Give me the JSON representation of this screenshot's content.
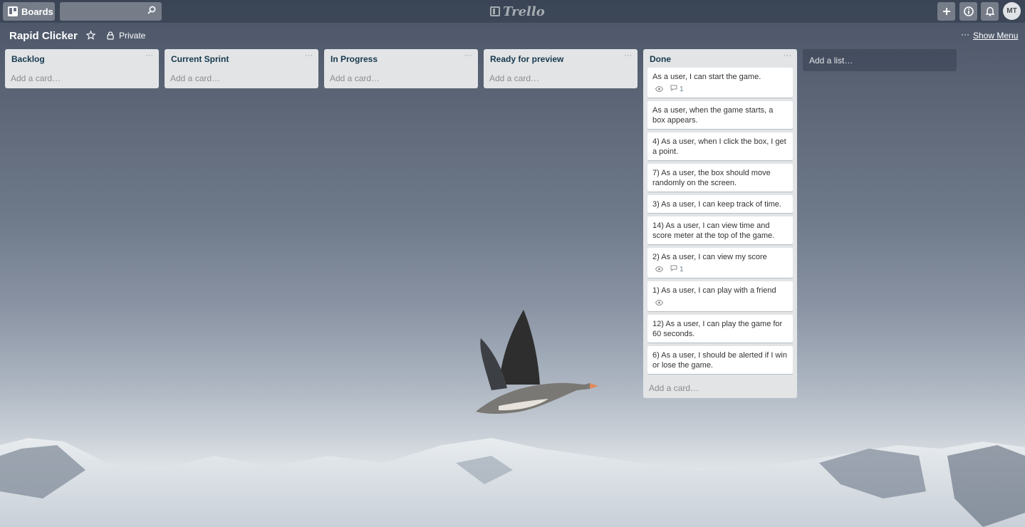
{
  "header": {
    "boards_label": "Boards",
    "search_value": "",
    "logo_text": "Trello",
    "avatar_initials": "MT"
  },
  "board": {
    "title": "Rapid Clicker",
    "privacy": "Private",
    "menu_dots": "···",
    "show_menu_label": "Show Menu"
  },
  "lists": [
    {
      "title": "Backlog",
      "menu": "···",
      "add_card": "Add a card…"
    },
    {
      "title": "Current Sprint",
      "menu": "···",
      "add_card": "Add a card…"
    },
    {
      "title": "In Progress",
      "menu": "···",
      "add_card": "Add a card…"
    },
    {
      "title": "Ready for preview",
      "menu": "···",
      "add_card": "Add a card…"
    },
    {
      "title": "Done",
      "menu": "···",
      "add_card": "Add a card…",
      "cards": [
        {
          "text": "As a user, I can start the game.",
          "watch": true,
          "comments": "1"
        },
        {
          "text": "As a user, when the game starts, a box appears."
        },
        {
          "text": "4) As a user, when I click the box, I get a point."
        },
        {
          "text": "7) As a user, the box should move randomly on the screen."
        },
        {
          "text": "3) As a user, I can keep track of time."
        },
        {
          "text": "14) As a user, I can view time and score meter at the top of the game."
        },
        {
          "text": "2) As a user, I can view my score",
          "watch": true,
          "comments": "1"
        },
        {
          "text": "1) As a user, I can play with a friend",
          "watch": true
        },
        {
          "text": "12) As a user, I can play the game for 60 seconds."
        },
        {
          "text": "6) As a user, I should be alerted if I win or lose the game."
        }
      ]
    }
  ],
  "add_list_label": "Add a list…",
  "icons": {
    "boards": "boards-icon",
    "search": "search-icon",
    "logo": "trello-logo-icon",
    "add": "plus-icon",
    "info": "info-icon",
    "notifications": "bell-icon",
    "star": "star-icon",
    "privacy": "lock-icon",
    "watch": "eye-icon",
    "comment": "comment-icon"
  },
  "colors": {
    "list_bg": "#e2e4e6",
    "card_bg": "#ffffff",
    "title_text": "#17394d"
  }
}
